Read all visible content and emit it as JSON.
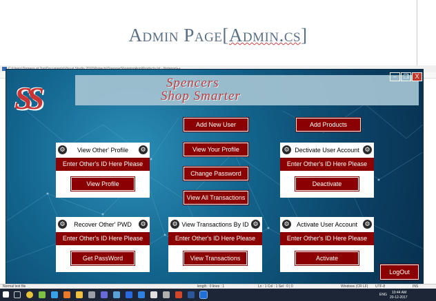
{
  "slide": {
    "title_prefix": "Admin Page[",
    "title_code": "Admin.cs",
    "title_suffix": "]"
  },
  "notepad": {
    "title": "C:\\Users\\Toppers at Top\\Documents\\Visual Studio 2010\\Projects\\SpencerShoppingApp\\Products.txt - Notepad++"
  },
  "window_controls": {
    "minimize": "–",
    "restore": "❐",
    "close": "X"
  },
  "banner": {
    "line1": "Spencers",
    "line2": "Shop Smarter",
    "logo": "SS"
  },
  "center_buttons": {
    "add_new_user": "Add New User",
    "view_your_profile": "View Your Profile",
    "change_password": "Change Password",
    "view_all_transactions": "View All Transactions"
  },
  "add_products": "Add Products",
  "logout": "LogOut",
  "panels": {
    "view_profile": {
      "title": "View Other' Profile",
      "input": "Enter Other's ID Here Please",
      "button": "View Profile"
    },
    "deactivate": {
      "title": "Dectivate User Account",
      "input": "Enter Other's ID Here Please",
      "button": "Deactivate"
    },
    "recover_pwd": {
      "title": "Recover Other' PWD",
      "input": "Enter Other's ID Here Please",
      "button": "Get PassWord"
    },
    "view_transactions": {
      "title": "View Transactions By ID",
      "input": "Enter Other's ID Here Please",
      "button": "View Transactions"
    },
    "activate": {
      "title": "Activate User Account",
      "input": "Enter Other's ID Here Please",
      "button": "Activate"
    }
  },
  "statusbar": {
    "file_type": "Normal text file",
    "length": "length : 0    lines : 1",
    "position": "Ln : 1    Col : 1    Sel : 0 | 0",
    "eol": "Windows (CR LF)",
    "encoding": "UTF-8",
    "mode": "INS"
  },
  "taskbar": {
    "lang": "ENG",
    "time": "10:44 AM",
    "date": "20-12-2017"
  }
}
